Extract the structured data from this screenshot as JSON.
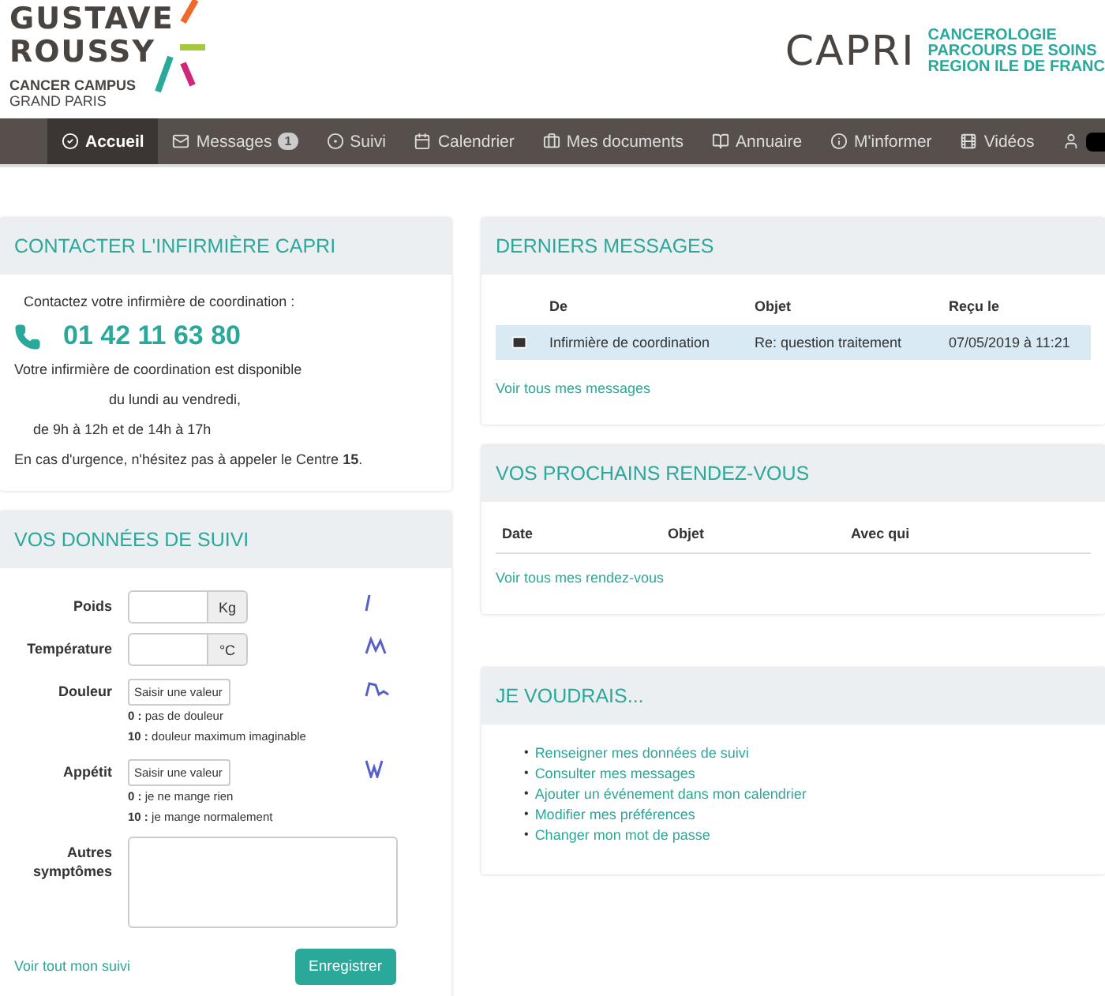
{
  "header": {
    "logo_lines": [
      "GUSTAVE",
      "ROUSSY"
    ],
    "logo_sub": [
      "CANCER CAMPUS",
      "GRAND PARIS"
    ],
    "brand": "CAPRI",
    "brand_lines": [
      "CANCEROLOGIE",
      "PARCOURS DE SOINS",
      "REGION ILE DE FRANC"
    ]
  },
  "nav": [
    {
      "label": "Accueil",
      "selected": true
    },
    {
      "label": "Messages",
      "badge": "1",
      "selected": false
    },
    {
      "label": "Suivi",
      "selected": false
    },
    {
      "label": "Calendrier",
      "selected": false
    },
    {
      "label": "Mes documents",
      "selected": false
    },
    {
      "label": "Annuaire",
      "selected": false
    },
    {
      "label": "M'informer",
      "selected": false
    },
    {
      "label": "Vidéos",
      "selected": false
    },
    {
      "selected": false
    }
  ],
  "contact": {
    "title": "CONTACTER L'INFIRMIÈRE CAPRI",
    "intro": "Contactez votre infirmière de coordination :",
    "phone": "01 42 11 63 80",
    "lines": [
      "Votre infirmière de coordination est disponible",
      "du lundi au vendredi,",
      "de 9h à 12h et de 14h à 17h"
    ],
    "urgent": "En cas d'urgence, n'hésitez pas à appeler le Centre **15**."
  },
  "tracking": {
    "title": "VOS DONNÉES DE SUIVI",
    "rows": [
      {
        "kind": "unit",
        "label": "Poids",
        "unit": "Kg"
      },
      {
        "kind": "unit",
        "label": "Température",
        "unit": "°C"
      },
      {
        "kind": "scale",
        "label": "Douleur",
        "placeholder": "Saisir une valeur",
        "hints": [
          "**0 :** pas de douleur",
          "**10 :** douleur maximum imaginable"
        ]
      },
      {
        "kind": "scale",
        "label": "Appétit",
        "placeholder": "Saisir une valeur",
        "hints": [
          "**0 :** je ne mange rien",
          "**10 :** je mange normalement"
        ]
      },
      {
        "kind": "text",
        "label": "Autres symptômes"
      }
    ],
    "link": "Voir tout mon suivi",
    "button": "Enregistrer"
  },
  "messages": {
    "title": "DERNIERS MESSAGES",
    "columns": [
      "De",
      "Objet",
      "Reçu le"
    ],
    "rows": [
      {
        "from": "Infirmière de coordination",
        "subject": "Re: question traitement",
        "date": "07/05/2019 à 11:21",
        "unread": true,
        "selected": true
      }
    ],
    "link": "Voir tous mes messages"
  },
  "appointments": {
    "title": "VOS PROCHAINS RENDEZ-VOUS",
    "columns": [
      "Date",
      "Objet",
      "Avec qui"
    ],
    "link": "Voir tous mes rendez-vous"
  },
  "wishes": {
    "title": "JE VOUDRAIS...",
    "bullet": "•",
    "links": [
      "Renseigner mes données de suivi",
      "Consulter mes messages",
      "Ajouter un événement dans mon calendrier",
      "Modifier mes préférences",
      "Changer mon mot de passe"
    ]
  }
}
